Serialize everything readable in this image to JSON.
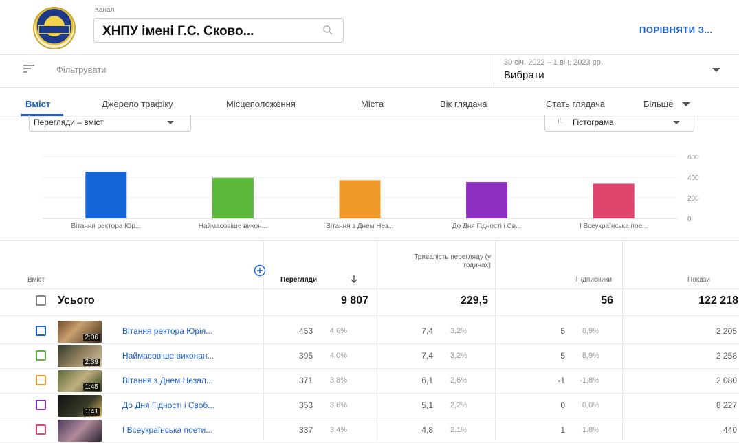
{
  "header": {
    "channel_caption": "Канал",
    "channel_name": "ХНПУ імені Г.С. Сково...",
    "compare_label": "ПОРІВНЯТИ З..."
  },
  "filter": {
    "label": "Фільтрувати",
    "date_range": "30 січ. 2022 – 1 віч. 2023 рр.",
    "date_choose": "Вибрати"
  },
  "tabs": [
    "Вміст",
    "Джерело трафіку",
    "Місцеположення",
    "Міста",
    "Вік глядача",
    "Стать глядача",
    "Більше"
  ],
  "metric_dropdown": "Перегляди – вміст",
  "chart_dropdown": "Гістограма",
  "chart_data": {
    "type": "bar",
    "categories": [
      "Вітання ректора Юр...",
      "Наймасовіше викон...",
      "Вітання з Днем Нез...",
      "До Дня Гідності і Св...",
      "І Всеукраїнська пое..."
    ],
    "values": [
      453,
      395,
      371,
      353,
      337
    ],
    "colors": [
      "#1565d8",
      "#5cb83a",
      "#ef9a28",
      "#8d2fc0",
      "#e0456e"
    ],
    "yticks": [
      "600",
      "400",
      "200",
      "0"
    ],
    "ylim": [
      0,
      600
    ]
  },
  "table": {
    "headers": {
      "content": "Вміст",
      "views": "Перегляди",
      "watch_time": "Тривалість перегляду (у годинах)",
      "subscribers": "Підписники",
      "impressions": "Покази"
    },
    "total": {
      "label": "Усього",
      "views": "9 807",
      "watch_time": "229,5",
      "subscribers": "56",
      "impressions": "122 218"
    },
    "rows": [
      {
        "title": "Вітання ректора Юрія...",
        "duration": "2:06",
        "check_color": "#1565d8",
        "views": "453",
        "views_pct": "4,6%",
        "watch": "7,4",
        "watch_pct": "3,2%",
        "subs": "5",
        "subs_pct": "8,9%",
        "impr": "2 205"
      },
      {
        "title": "Наймасовіше виконан...",
        "duration": "2:39",
        "check_color": "#5cb83a",
        "views": "395",
        "views_pct": "4,0%",
        "watch": "7,4",
        "watch_pct": "3,2%",
        "subs": "5",
        "subs_pct": "8,9%",
        "impr": "2 258"
      },
      {
        "title": "Вітання з Днем Незал...",
        "duration": "1:45",
        "check_color": "#ef9a28",
        "views": "371",
        "views_pct": "3,8%",
        "watch": "6,1",
        "watch_pct": "2,6%",
        "subs": "-1",
        "subs_pct": "-1,8%",
        "impr": "2 080"
      },
      {
        "title": "До Дня Гідності і Своб...",
        "duration": "1:41",
        "check_color": "#8d2fc0",
        "views": "353",
        "views_pct": "3,6%",
        "watch": "5,1",
        "watch_pct": "2,2%",
        "subs": "0",
        "subs_pct": "0,0%",
        "impr": "8 227"
      },
      {
        "title": "І Всеукраїнська поети...",
        "duration": "",
        "check_color": "#e0456e",
        "views": "337",
        "views_pct": "3,4%",
        "watch": "4,8",
        "watch_pct": "2,1%",
        "subs": "1",
        "subs_pct": "1,8%",
        "impr": "440"
      }
    ]
  }
}
